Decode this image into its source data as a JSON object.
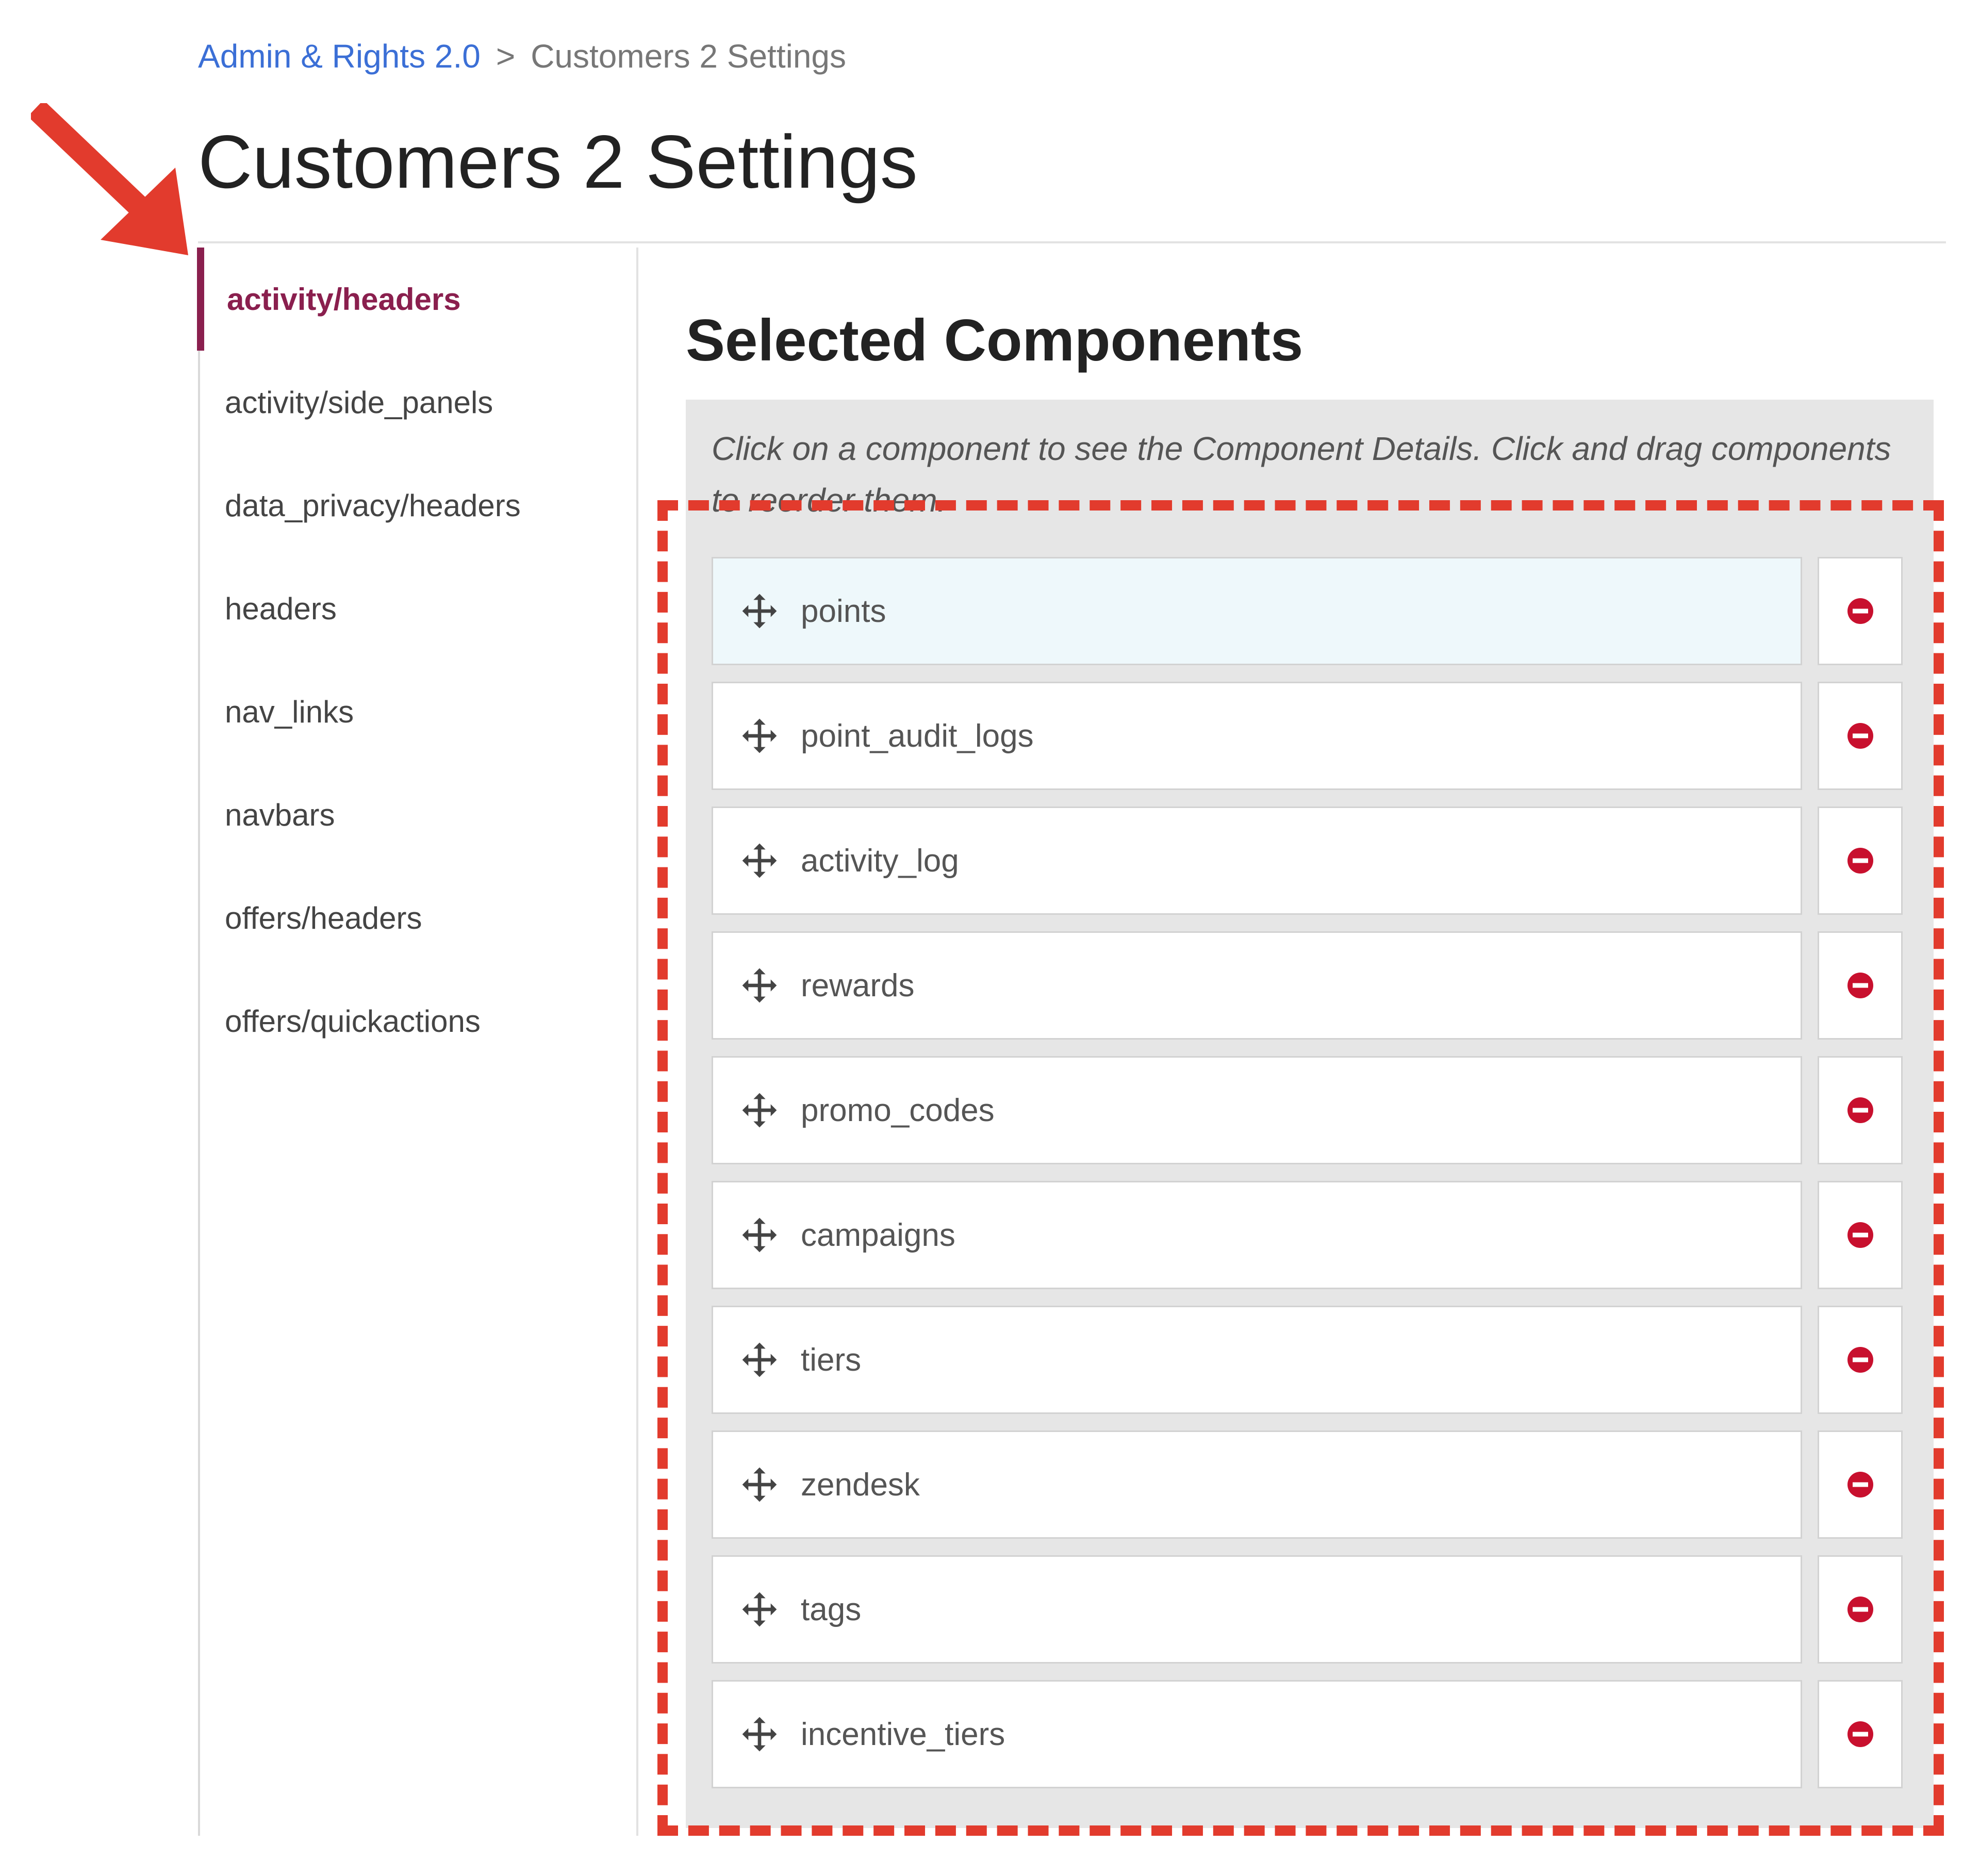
{
  "breadcrumb": {
    "parent": "Admin & Rights 2.0",
    "separator": ">",
    "current": "Customers 2 Settings"
  },
  "page": {
    "title": "Customers 2 Settings"
  },
  "sidebar": {
    "items": [
      {
        "label": "activity/headers",
        "active": true
      },
      {
        "label": "activity/side_panels"
      },
      {
        "label": "data_privacy/headers"
      },
      {
        "label": "headers"
      },
      {
        "label": "nav_links"
      },
      {
        "label": "navbars"
      },
      {
        "label": "offers/headers"
      },
      {
        "label": "offers/quickactions"
      }
    ]
  },
  "main": {
    "section_title": "Selected Components",
    "instructions": "Click on a component to see the Component Details. Click and drag components to reorder them.",
    "components": [
      {
        "label": "points"
      },
      {
        "label": "point_audit_logs"
      },
      {
        "label": "activity_log"
      },
      {
        "label": "rewards"
      },
      {
        "label": "promo_codes"
      },
      {
        "label": "campaigns"
      },
      {
        "label": "tiers"
      },
      {
        "label": "zendesk"
      },
      {
        "label": "tags"
      },
      {
        "label": "incentive_tiers"
      }
    ]
  },
  "icons": {
    "drag": "move-arrows-icon",
    "remove": "remove-minus-circle-icon"
  },
  "colors": {
    "accent": "#8a1f4e",
    "link": "#3b6fd6",
    "annotation": "#e23b2d",
    "remove": "#c8102e",
    "first_row_bg": "#eef8fb"
  }
}
